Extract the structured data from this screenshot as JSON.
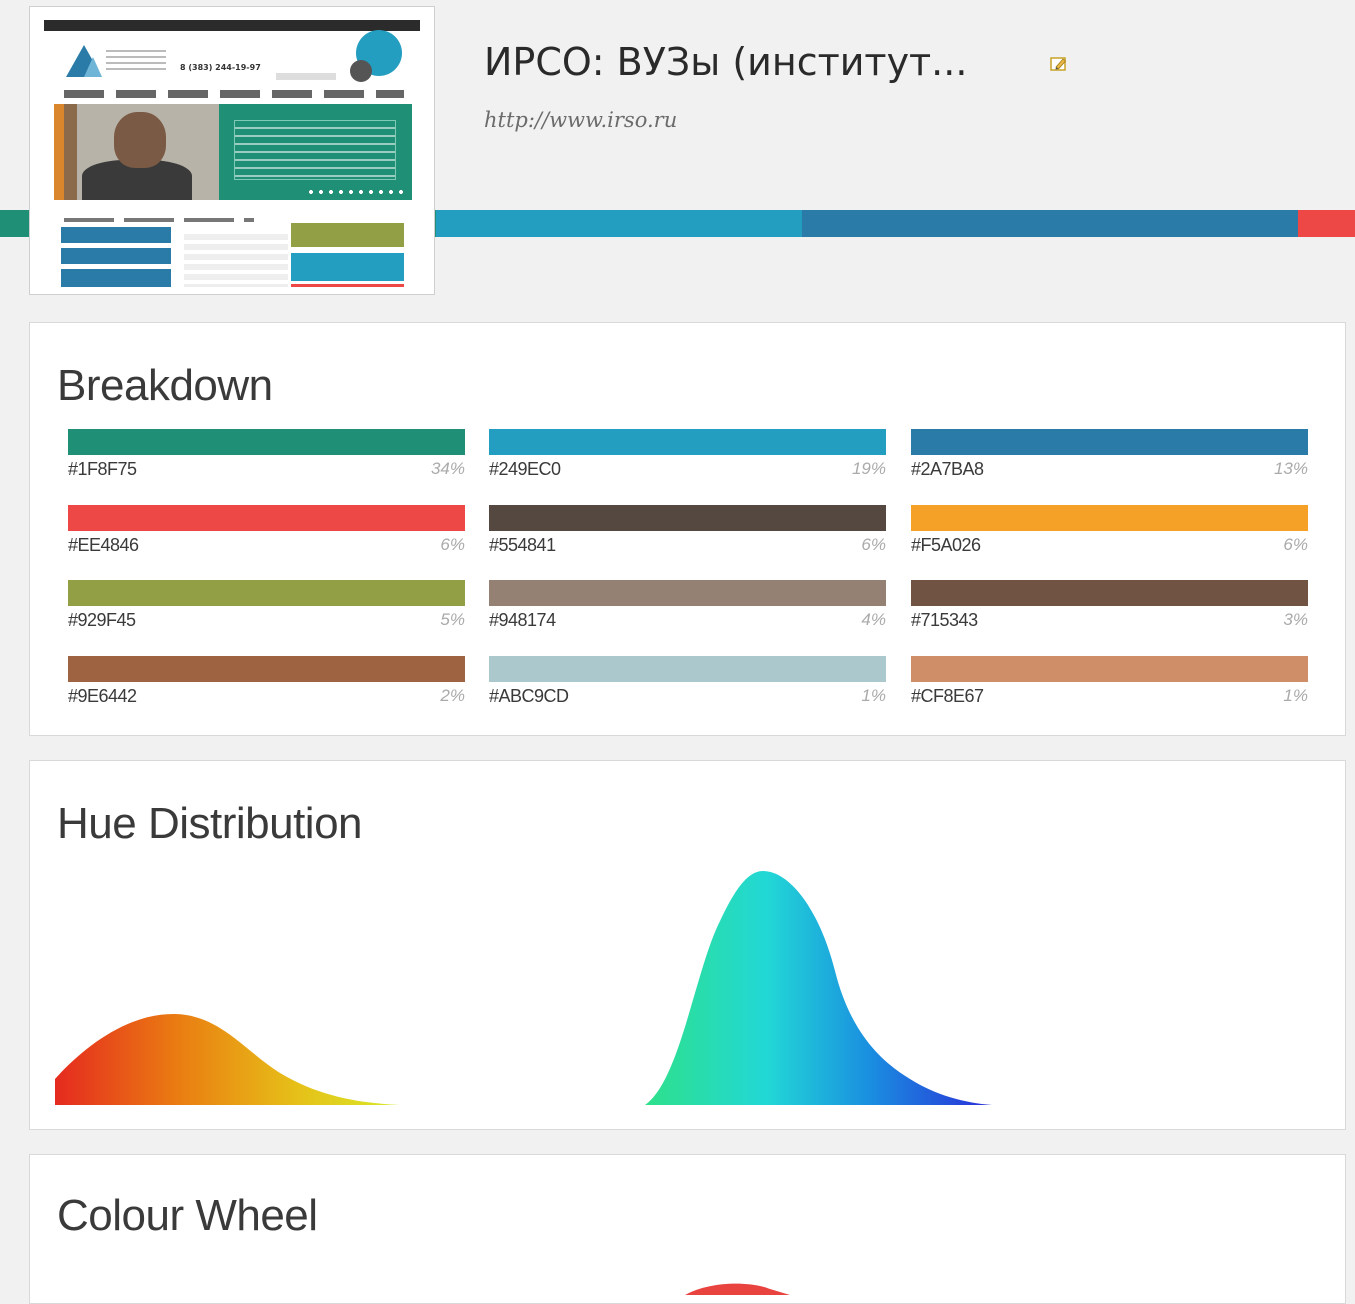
{
  "header": {
    "title": "ИРСО: ВУЗы (институт...",
    "url": "http://www.irso.ru",
    "thumbnail_phone": "8 (383) 244-19-97"
  },
  "strip_colors": [
    "#1F8F75",
    "#249EC0",
    "#2A7BA8",
    "#EE4846"
  ],
  "breakdown": {
    "title": "Breakdown",
    "swatches": [
      {
        "hex": "#1F8F75",
        "pct": "34%"
      },
      {
        "hex": "#249EC0",
        "pct": "19%"
      },
      {
        "hex": "#2A7BA8",
        "pct": "13%"
      },
      {
        "hex": "#EE4846",
        "pct": "6%"
      },
      {
        "hex": "#554841",
        "pct": "6%"
      },
      {
        "hex": "#F5A026",
        "pct": "6%"
      },
      {
        "hex": "#929F45",
        "pct": "5%"
      },
      {
        "hex": "#948174",
        "pct": "4%"
      },
      {
        "hex": "#715343",
        "pct": "3%"
      },
      {
        "hex": "#9E6442",
        "pct": "2%"
      },
      {
        "hex": "#ABC9CD",
        "pct": "1%"
      },
      {
        "hex": "#CF8E67",
        "pct": "1%"
      }
    ]
  },
  "hue_distribution": {
    "title": "Hue Distribution"
  },
  "colour_wheel": {
    "title": "Colour Wheel"
  }
}
